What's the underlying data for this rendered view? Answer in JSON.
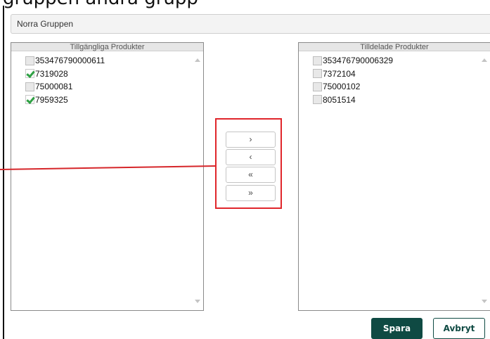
{
  "page": {
    "heading_fragment": "gruppen  ändra grupp"
  },
  "group_field": {
    "value": "Norra Gruppen"
  },
  "available": {
    "header": "Tillgängliga Produkter",
    "items": [
      {
        "label": "353476790000611",
        "checked": false
      },
      {
        "label": "7319028",
        "checked": true
      },
      {
        "label": "75000081",
        "checked": false
      },
      {
        "label": "7959325",
        "checked": true
      }
    ]
  },
  "assigned": {
    "header": "Tilldelade Produkter",
    "items": [
      {
        "label": "353476790006329",
        "checked": false
      },
      {
        "label": "7372104",
        "checked": false
      },
      {
        "label": "75000102",
        "checked": false
      },
      {
        "label": "8051514",
        "checked": false
      }
    ]
  },
  "transfer": {
    "move_right": "›",
    "move_left": "‹",
    "move_all_left": "«",
    "move_all_right": "»"
  },
  "actions": {
    "save": "Spara",
    "cancel": "Avbryt"
  },
  "colors": {
    "primary": "#0f4a43",
    "callout": "#e0262b",
    "check": "#2ea043"
  }
}
